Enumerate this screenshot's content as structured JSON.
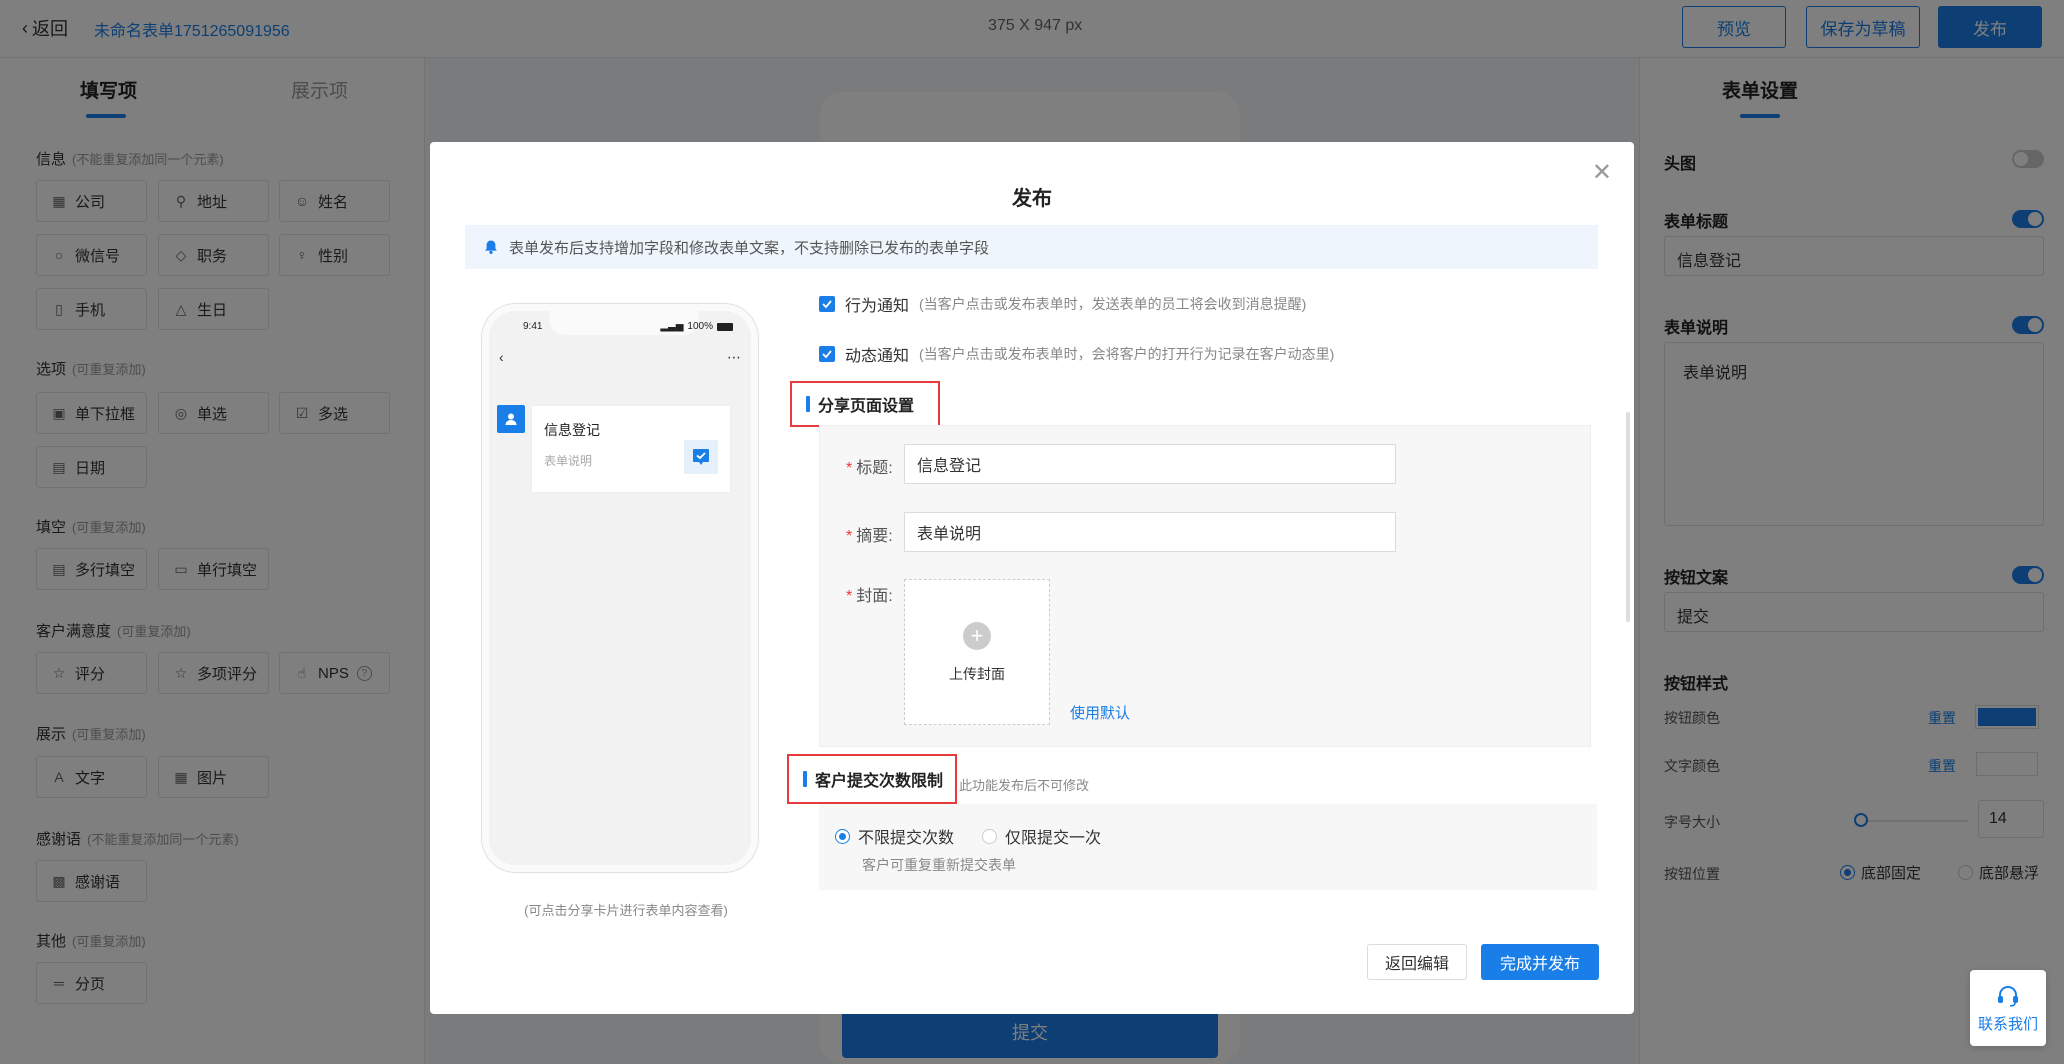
{
  "topbar": {
    "back_label": "返回",
    "form_name": "未命名表单1751265091956",
    "size_info": "375 X 947 px",
    "preview_label": "预览",
    "draft_label": "保存为草稿",
    "publish_label": "发布"
  },
  "left_panel": {
    "tab_fill": "填写项",
    "tab_display": "展示项",
    "sections": {
      "info": {
        "title": "信息",
        "hint": "(不能重复添加同一个元素)"
      },
      "options": {
        "title": "选项",
        "hint": "(可重复添加)"
      },
      "blanks": {
        "title": "填空",
        "hint": "(可重复添加)"
      },
      "satisfaction": {
        "title": "客户满意度",
        "hint": "(可重复添加)"
      },
      "display": {
        "title": "展示",
        "hint": "(可重复添加)"
      },
      "thanks": {
        "title": "感谢语",
        "hint": "(不能重复添加同一个元素)"
      },
      "other": {
        "title": "其他",
        "hint": "(可重复添加)"
      }
    },
    "fields": {
      "company": "公司",
      "address": "地址",
      "name": "姓名",
      "wechat": "微信号",
      "position": "职务",
      "gender": "性别",
      "phone": "手机",
      "birthday": "生日",
      "dropdown": "单下拉框",
      "single": "单选",
      "multi": "多选",
      "date": "日期",
      "multiline": "多行填空",
      "singleline": "单行填空",
      "rating": "评分",
      "multirating": "多项评分",
      "nps": "NPS",
      "text": "文字",
      "image": "图片",
      "thanks": "感谢语",
      "pagebreak": "分页"
    }
  },
  "canvas": {
    "submit_label": "提交"
  },
  "right_panel": {
    "title": "表单设置",
    "header_image_label": "头图",
    "form_title_label": "表单标题",
    "form_title_value": "信息登记",
    "form_desc_label": "表单说明",
    "form_desc_value": "表单说明",
    "button_text_label": "按钮文案",
    "button_text_value": "提交",
    "button_style_label": "按钮样式",
    "button_color_label": "按钮颜色",
    "text_color_label": "文字颜色",
    "reset_label": "重置",
    "font_size_label": "字号大小",
    "font_size_value": "14",
    "button_position_label": "按钮位置",
    "pos_fixed": "底部固定",
    "pos_float": "底部悬浮",
    "accent_color": "#1a7ee8"
  },
  "modal": {
    "title": "发布",
    "notice": "表单发布后支持增加字段和修改表单文案，不支持删除已发布的表单字段",
    "phone": {
      "time": "9:41",
      "battery": "100%",
      "card_title": "信息登记",
      "card_desc": "表单说明",
      "caption": "(可点击分享卡片进行表单内容查看)"
    },
    "behavior_notice_label": "行为通知",
    "behavior_notice_hint": "(当客户点击或发布表单时，发送表单的员工将会收到消息提醒)",
    "dynamic_notice_label": "动态通知",
    "dynamic_notice_hint": "(当客户点击或发布表单时，会将客户的打开行为记录在客户动态里)",
    "share_section_title": "分享页面设置",
    "title_label": "标题:",
    "title_value": "信息登记",
    "summary_label": "摘要:",
    "summary_value": "表单说明",
    "cover_label": "封面:",
    "upload_cover_label": "上传封面",
    "use_default_label": "使用默认",
    "limit_section_title": "客户提交次数限制",
    "limit_section_hint": "此功能发布后不可修改",
    "unlimited_label": "不限提交次数",
    "once_label": "仅限提交一次",
    "resubmit_hint": "客户可重复重新提交表单",
    "back_edit_label": "返回编辑",
    "finish_publish_label": "完成并发布"
  },
  "contact_label": "联系我们"
}
